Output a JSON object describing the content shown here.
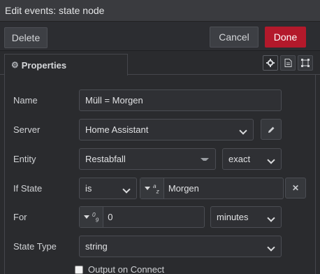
{
  "titlebar": {
    "title": "Edit events: state node"
  },
  "toolbar": {
    "delete_label": "Delete",
    "cancel_label": "Cancel",
    "done_label": "Done"
  },
  "tabs": {
    "properties_label": "Properties"
  },
  "form": {
    "name": {
      "label": "Name",
      "value": "Müll = Morgen"
    },
    "server": {
      "label": "Server",
      "value": "Home Assistant"
    },
    "entity": {
      "label": "Entity",
      "value": "Restabfall",
      "match": "exact"
    },
    "if_state": {
      "label": "If State",
      "operator": "is",
      "type_symbol": "a z",
      "value": "Morgen"
    },
    "for": {
      "label": "For",
      "type_symbol": "0 9",
      "value": "0",
      "unit": "minutes"
    },
    "state_type": {
      "label": "State Type",
      "value": "string"
    },
    "output_on_connect": {
      "label": "Output on Connect",
      "checked": false
    }
  },
  "icons": [
    "gear-icon",
    "edit-icon",
    "trash-icon",
    "description-icon",
    "appearance-icon",
    "close-icon"
  ],
  "colors": {
    "accent": "#b3192b",
    "background": "#2a2b2e"
  }
}
